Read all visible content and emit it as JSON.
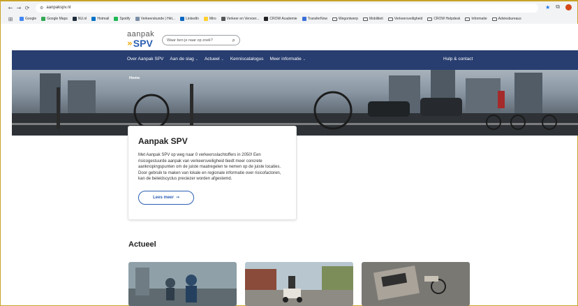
{
  "browser": {
    "url": "aanpakspv.nl",
    "bookmarks": [
      {
        "label": "Google",
        "icon": "google-icon",
        "color": "#4285f4"
      },
      {
        "label": "Google Maps",
        "icon": "maps-icon",
        "color": "#34a853"
      },
      {
        "label": "NU.nl",
        "icon": "nu-icon",
        "color": "#1f2d3d"
      },
      {
        "label": "Hotmail",
        "icon": "hotmail-icon",
        "color": "#0072c6"
      },
      {
        "label": "Spotify",
        "icon": "spotify-icon",
        "color": "#1db954"
      },
      {
        "label": "Verkeerskunde | Hét...",
        "icon": "verkeerskunde-icon",
        "color": "#7b8fa6"
      },
      {
        "label": "LinkedIn",
        "icon": "linkedin-icon",
        "color": "#0a66c2"
      },
      {
        "label": "Miro",
        "icon": "miro-icon",
        "color": "#ffd02f"
      },
      {
        "label": "Verkeer en Vervoer...",
        "icon": "globe-icon",
        "color": "#555555"
      },
      {
        "label": "CROW Academie",
        "icon": "crow-icon",
        "color": "#222222"
      },
      {
        "label": "TransferNow",
        "icon": "transfernow-icon",
        "color": "#3a6fd8"
      },
      {
        "label": "Wegontwerp",
        "icon": "folder-icon",
        "color": ""
      },
      {
        "label": "Mobiliteit",
        "icon": "folder-icon",
        "color": ""
      },
      {
        "label": "Verkeersveiligheid",
        "icon": "folder-icon",
        "color": ""
      },
      {
        "label": "CROW Helpdesk",
        "icon": "folder-icon",
        "color": ""
      },
      {
        "label": "Informatie",
        "icon": "folder-icon",
        "color": ""
      },
      {
        "label": "Adviesbureaus",
        "icon": "folder-icon",
        "color": ""
      }
    ]
  },
  "site": {
    "logo_top": "aanpak",
    "logo_bottom": "SPV",
    "search_placeholder": "Waar ben je naar op zoek?",
    "nav": [
      {
        "label": "Over Aanpak SPV",
        "dropdown": false
      },
      {
        "label": "Aan de slag",
        "dropdown": true
      },
      {
        "label": "Actueel",
        "dropdown": true
      },
      {
        "label": "Kenniscatalogus",
        "dropdown": false
      },
      {
        "label": "Meer informatie",
        "dropdown": true
      }
    ],
    "nav_right": "Hulp & contact",
    "breadcrumb": "Home",
    "card": {
      "title": "Aanpak SPV",
      "text": "Met Aanpak SPV op weg naar 0 verkeersslachtoffers in 2050! Een risicogestuurde aanpak van verkeersveiligheid biedt meer concrete aanknopingspunten om de juiste maatregelen te nemen op de juiste locaties. Door gebruik te maken van lokale en regionale informatie over risicofactoren, kan de beleidscyclus preciezer worden afgestemd.",
      "button": "Lees meer"
    },
    "section_title": "Actueel"
  },
  "colors": {
    "nav_bg": "#283e70",
    "brand_blue": "#2b5fb4",
    "brand_orange": "#f0a500"
  }
}
